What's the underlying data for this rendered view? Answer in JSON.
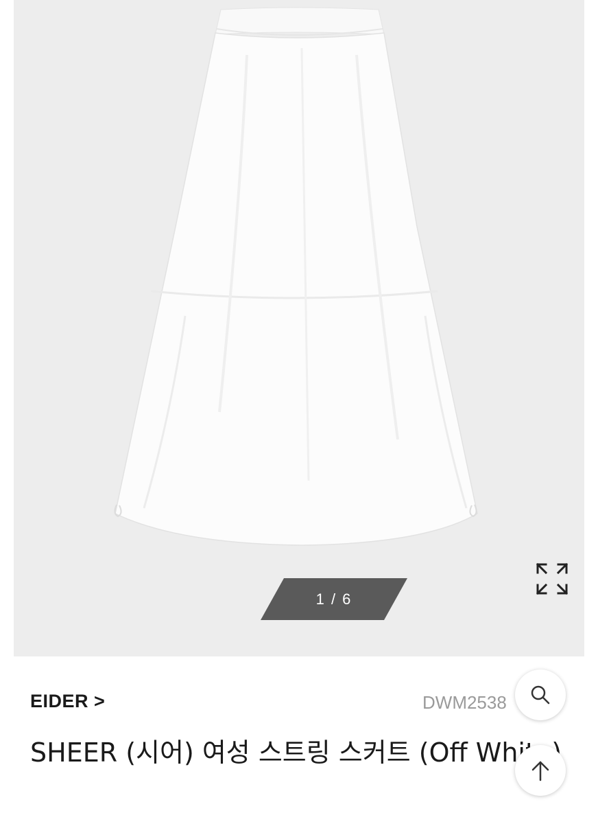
{
  "gallery": {
    "counter_text": "1 / 6",
    "counter_bg": "#5a5a5a",
    "background": "#ededed",
    "expand_icon": "expand-arrows-icon"
  },
  "product": {
    "brand": "EIDER >",
    "code": "DWM2538",
    "title": "SHEER (시어) 여성 스트링 스커트 (Off White)"
  },
  "floating_buttons": {
    "search_icon": "search-icon",
    "top_icon": "arrow-up-icon"
  }
}
